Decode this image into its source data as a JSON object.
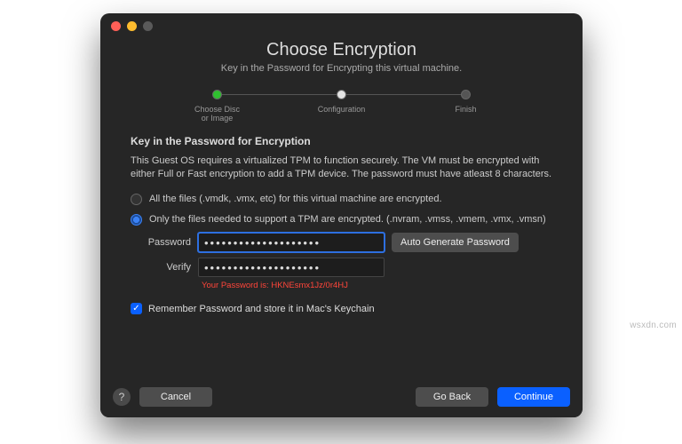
{
  "traffic_lights": {
    "close": "#ff5f57",
    "min": "#febc2e",
    "max": "#5a5a5a"
  },
  "header": {
    "title": "Choose Encryption",
    "subtitle": "Key in the Password for Encrypting this virtual machine."
  },
  "stepper": {
    "items": [
      {
        "label": "Choose Disc\nor Image",
        "color": "#2fbf2f"
      },
      {
        "label": "Configuration",
        "color": "#e4e4e4"
      },
      {
        "label": "Finish",
        "color": "#555"
      }
    ]
  },
  "section": {
    "heading": "Key in the Password for Encryption",
    "desc": "This Guest OS requires a virtualized TPM to function securely. The VM must be encrypted with either Full or Fast encryption to add a TPM device. The password must have atleast 8 characters."
  },
  "radios": {
    "opt1": "All the files (.vmdk, .vmx, etc) for this virtual machine are encrypted.",
    "opt2": "Only the files needed to support a TPM are encrypted. (.nvram, .vmss, .vmem, .vmx, .vmsn)",
    "selected": 2
  },
  "password": {
    "label": "Password",
    "value": "••••••••••••••••••••",
    "verify_label": "Verify",
    "verify_value": "••••••••••••••••••••",
    "autogen": "Auto Generate Password",
    "hint_prefix": "Your Password is: ",
    "hint_value": "HKNEsmx1Jz/0r4HJ"
  },
  "remember": {
    "checked": true,
    "label": "Remember Password and store it in Mac's Keychain"
  },
  "footer": {
    "help": "?",
    "cancel": "Cancel",
    "back": "Go Back",
    "continue": "Continue"
  },
  "watermark": "wsxdn.com"
}
